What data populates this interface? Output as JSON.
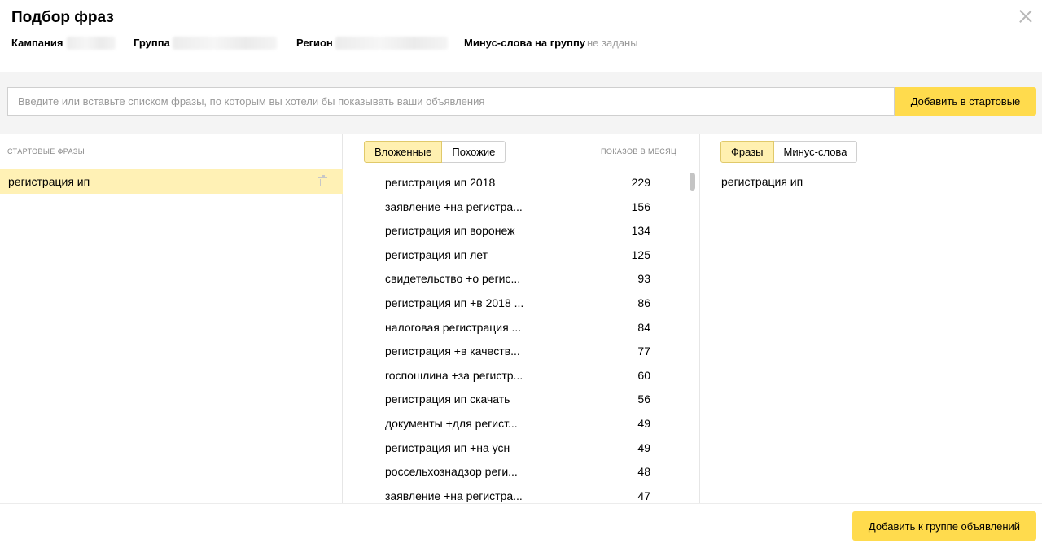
{
  "dialog": {
    "title": "Подбор фраз",
    "close_icon": "close-icon"
  },
  "meta": {
    "campaign_label": "Кампания",
    "group_label": "Группа",
    "region_label": "Регион",
    "minus_words_label": "Минус-слова на группу",
    "minus_words_value": "не заданы"
  },
  "search": {
    "placeholder": "Введите или вставьте списком фразы, по которым вы хотели бы показывать ваши объявления",
    "value": "",
    "add_button": "Добавить в стартовые"
  },
  "start_phrases": {
    "header": "Стартовые фразы",
    "items": [
      {
        "label": "регистрация ип",
        "icon": "trash-icon"
      }
    ]
  },
  "suggestions": {
    "tabs": [
      {
        "label": "Вложенные",
        "active": true
      },
      {
        "label": "Похожие",
        "active": false
      }
    ],
    "count_header": "Показов в месяц",
    "rows": [
      {
        "phrase": "регистрация ип 2018",
        "count": "229"
      },
      {
        "phrase": "заявление +на регистра...",
        "count": "156"
      },
      {
        "phrase": "регистрация ип воронеж",
        "count": "134"
      },
      {
        "phrase": "регистрация ип лет",
        "count": "125"
      },
      {
        "phrase": "свидетельство +о регис...",
        "count": "93"
      },
      {
        "phrase": "регистрация ип +в 2018 ...",
        "count": "86"
      },
      {
        "phrase": "налоговая регистрация ...",
        "count": "84"
      },
      {
        "phrase": "регистрация +в качеств...",
        "count": "77"
      },
      {
        "phrase": "госпошлина +за регистр...",
        "count": "60"
      },
      {
        "phrase": "регистрация ип скачать",
        "count": "56"
      },
      {
        "phrase": "документы +для регист...",
        "count": "49"
      },
      {
        "phrase": "регистрация ип +на усн",
        "count": "49"
      },
      {
        "phrase": "россельхознадзор реги...",
        "count": "48"
      },
      {
        "phrase": "заявление +на регистра...",
        "count": "47"
      }
    ]
  },
  "result": {
    "tabs": [
      {
        "label": "Фразы",
        "active": true
      },
      {
        "label": "Минус-слова",
        "active": false
      }
    ],
    "items": [
      {
        "label": "регистрация ип"
      }
    ]
  },
  "footer": {
    "add_button": "Добавить к группе объявлений"
  },
  "colors": {
    "accent_yellow": "#ffdb4d",
    "selected_row": "#fff1b5",
    "active_tab": "#fff0b0",
    "search_band": "#f4f4f4"
  }
}
